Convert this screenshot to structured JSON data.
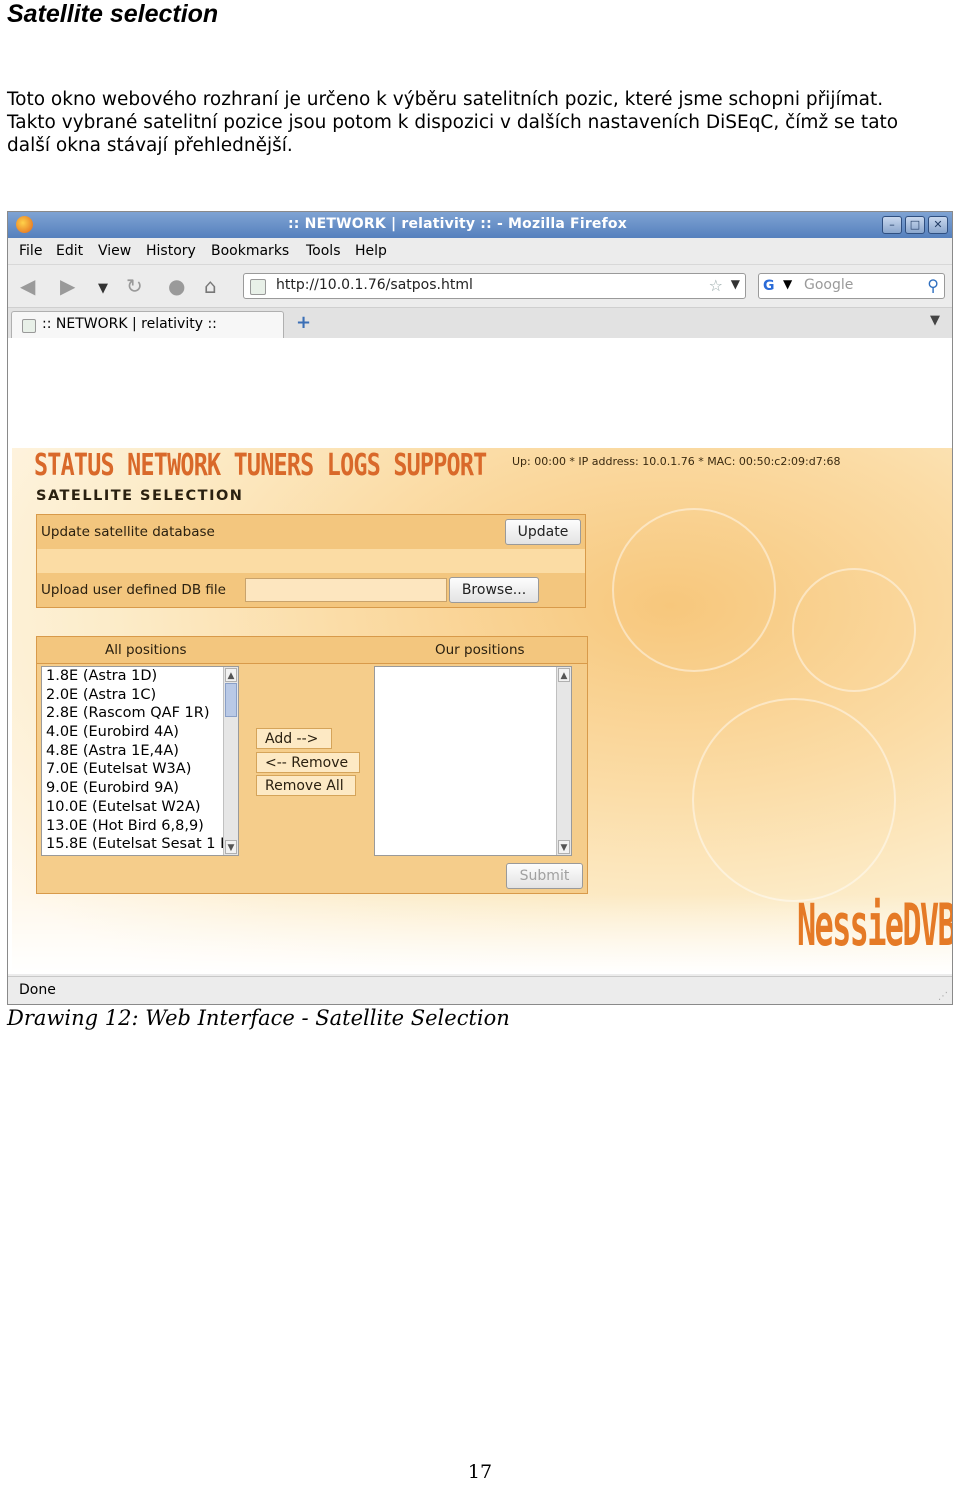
{
  "heading": "Satellite selection",
  "intro": {
    "line1": "Toto okno webového rozhraní je určeno k výběru satelitních pozic, které jsme schopni přijímat.",
    "line2": "Takto vybrané satelitní pozice jsou potom k dispozici v dalších nastaveních DiSEqC, čímž se tato",
    "line3": "další okna stávají přehlednější."
  },
  "browser": {
    "window_title": ":: NETWORK | relativity :: - Mozilla Firefox",
    "menu": [
      "File",
      "Edit",
      "View",
      "History",
      "Bookmarks",
      "Tools",
      "Help"
    ],
    "url": "http://10.0.1.76/satpos.html",
    "search_placeholder": "Google",
    "tab_title": ":: NETWORK | relativity ::",
    "status": "Done"
  },
  "page": {
    "nav_title": "STATUS NETWORK TUNERS LOGS SUPPORT",
    "sysinfo": "Up: 00:00 * IP address: 10.0.1.76 * MAC: 00:50:c2:09:d7:68",
    "section_title": "SATELLITE SELECTION",
    "update_label": "Update satellite database",
    "update_button": "Update",
    "upload_label": "Upload user defined DB file",
    "browse_button": "Browse...",
    "all_positions_header": "All positions",
    "our_positions_header": "Our positions",
    "all_positions": [
      "1.8E (Astra 1D)",
      "2.0E (Astra 1C)",
      "2.8E (Rascom QAF 1R)",
      "4.0E (Eurobird 4A)",
      "4.8E (Astra 1E,4A)",
      "7.0E (Eutelsat W3A)",
      "9.0E (Eurobird 9A)",
      "10.0E (Eutelsat W2A)",
      "13.0E (Hot Bird 6,8,9)",
      "15.8E (Eutelsat Sesat 1 E"
    ],
    "add_button": "Add -->",
    "remove_button": "<-- Remove",
    "remove_all_button": "Remove All",
    "submit_button": "Submit",
    "logo": "NessieDVB"
  },
  "caption": "Drawing 12: Web Interface - Satellite Selection",
  "page_number": "17"
}
